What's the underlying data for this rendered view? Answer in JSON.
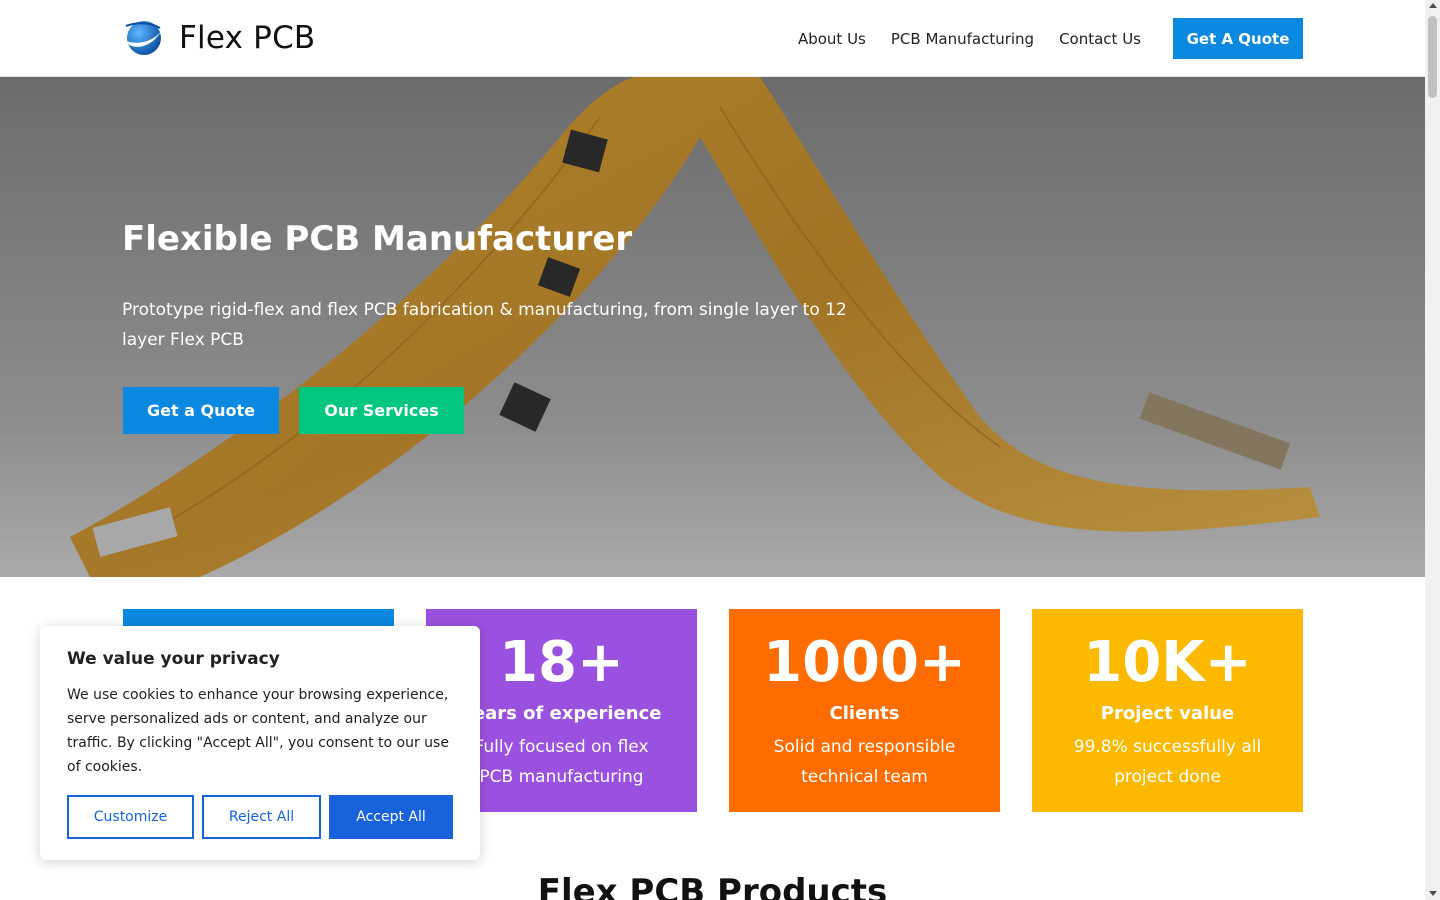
{
  "header": {
    "logo_text": "Flex PCB",
    "nav": [
      "About Us",
      "PCB Manufacturing",
      "Contact Us"
    ],
    "cta_label": "Get A Quote"
  },
  "hero": {
    "title": "Flexible PCB Manufacturer",
    "subtitle": "Prototype rigid-flex and flex PCB fabrication & manufacturing, from single layer to 12 layer Flex PCB",
    "primary_button": "Get a Quote",
    "secondary_button": "Our Services"
  },
  "stats": [
    {
      "number": "",
      "title": "",
      "desc": "",
      "color": "#0b88e0"
    },
    {
      "number": "18+",
      "title": "Years of experience",
      "desc": "Fully focused on flex PCB manufacturing",
      "color": "#9b51e0"
    },
    {
      "number": "1000+",
      "title": "Clients",
      "desc": "Solid and responsible technical team",
      "color": "#ff6d00"
    },
    {
      "number": "10K+",
      "title": "Project value",
      "desc": "99.8% successfully all project done",
      "color": "#fcb900"
    }
  ],
  "products": {
    "title": "Flex PCB Products"
  },
  "cookie": {
    "title": "We value your privacy",
    "text": "We use cookies to enhance your browsing experience, serve personalized ads or content, and analyze our traffic. By clicking \"Accept All\", you consent to our use of cookies.",
    "customize": "Customize",
    "reject": "Reject All",
    "accept": "Accept All"
  },
  "colors": {
    "accent": "#0b88e0",
    "green": "#00c77f",
    "cookie_blue": "#1863dc"
  },
  "icons": {
    "logo": "globe-swoosh-icon"
  }
}
